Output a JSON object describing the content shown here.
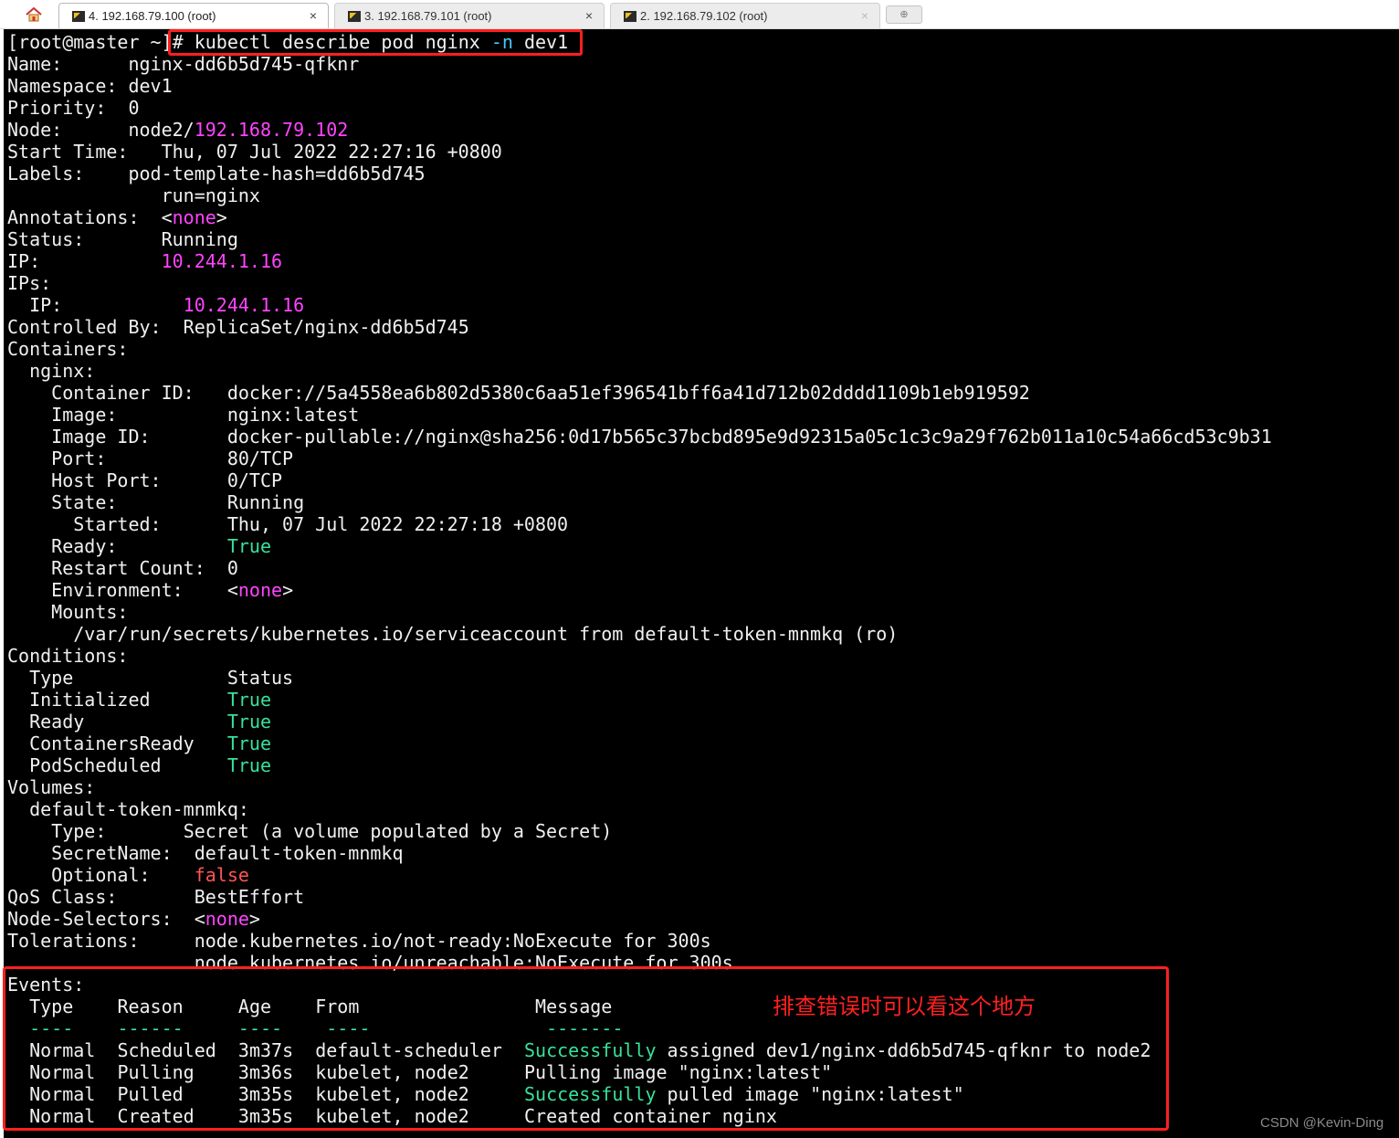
{
  "tabs": [
    {
      "label": "4. 192.168.79.100 (root)",
      "close": "×"
    },
    {
      "label": "3. 192.168.79.101 (root)",
      "close": "×"
    },
    {
      "label": "2. 192.168.79.102 (root)",
      "close": "×"
    }
  ],
  "prompt": "[root@master ~]",
  "command": {
    "prefix": "# kubectl describe pod nginx ",
    "flag": "-n",
    "suffix": " dev1"
  },
  "pod": {
    "name_label": "Name:",
    "name": "nginx-dd6b5d745-qfknr",
    "namespace_label": "Namespace:",
    "namespace": "dev1",
    "priority_label": "Priority:",
    "priority": "0",
    "node_label": "Node:",
    "node_prefix": "node2/",
    "node_ip": "192.168.79.102",
    "start_label": "Start Time:",
    "start_time": "Thu, 07 Jul 2022 22:27:16 +0800",
    "labels_label": "Labels:",
    "label1": "pod-template-hash=dd6b5d745",
    "label2": "run=nginx",
    "annotations_label": "Annotations:",
    "annotations": "none",
    "status_label": "Status:",
    "status": "Running",
    "ip_label": "IP:",
    "ip": "10.244.1.16",
    "ips_label": "IPs:",
    "ips_ip_label": "IP:",
    "ips_ip": "10.244.1.16",
    "controlled_label": "Controlled By:",
    "controlled_by": "ReplicaSet/nginx-dd6b5d745"
  },
  "containers": {
    "label": "Containers:",
    "name": "nginx:",
    "container_id_label": "Container ID:",
    "container_id": "docker://5a4558ea6b802d5380c6aa51ef396541bff6a41d712b02dddd1109b1eb919592",
    "image_label": "Image:",
    "image": "nginx:latest",
    "image_id_label": "Image ID:",
    "image_id": "docker-pullable://nginx@sha256:0d17b565c37bcbd895e9d92315a05c1c3c9a29f762b011a10c54a66cd53c9b31",
    "port_label": "Port:",
    "port": "80/TCP",
    "host_port_label": "Host Port:",
    "host_port": "0/TCP",
    "state_label": "State:",
    "state": "Running",
    "started_label": "Started:",
    "started": "Thu, 07 Jul 2022 22:27:18 +0800",
    "ready_label": "Ready:",
    "ready": "True",
    "restart_label": "Restart Count:",
    "restart": "0",
    "env_label": "Environment:",
    "env": "none",
    "mounts_label": "Mounts:",
    "mount": "/var/run/secrets/kubernetes.io/serviceaccount from default-token-mnmkq (ro)"
  },
  "conditions": {
    "label": "Conditions:",
    "type_header": "Type",
    "status_header": "Status",
    "rows": [
      {
        "type": "Initialized",
        "status": "True"
      },
      {
        "type": "Ready",
        "status": "True"
      },
      {
        "type": "ContainersReady",
        "status": "True"
      },
      {
        "type": "PodScheduled",
        "status": "True"
      }
    ]
  },
  "volumes": {
    "label": "Volumes:",
    "name": "default-token-mnmkq:",
    "type_label": "Type:",
    "type": "Secret (a volume populated by a Secret)",
    "secret_label": "SecretName:",
    "secret": "default-token-mnmkq",
    "optional_label": "Optional:",
    "optional": "false"
  },
  "qos_label": "QoS Class:",
  "qos": "BestEffort",
  "selectors_label": "Node-Selectors:",
  "selectors": "none",
  "tolerations_label": "Tolerations:",
  "toleration1": "node.kubernetes.io/not-ready:NoExecute for 300s",
  "toleration2": "node.kubernetes.io/unreachable:NoExecute for 300s",
  "events": {
    "label": "Events:",
    "headers": {
      "type": "Type",
      "reason": "Reason",
      "age": "Age",
      "from": "From",
      "message": "Message"
    },
    "dashes": {
      "type": "----",
      "reason": "------",
      "age": "----",
      "from": "----",
      "message": "-------"
    },
    "rows": [
      {
        "type": "Normal",
        "reason": "Scheduled",
        "age": "3m37s",
        "from": "default-scheduler",
        "msg_hl": "Successfully",
        "msg": " assigned dev1/nginx-dd6b5d745-qfknr to node2"
      },
      {
        "type": "Normal",
        "reason": "Pulling",
        "age": "3m36s",
        "from": "kubelet, node2",
        "msg_hl": "",
        "msg": "Pulling image \"nginx:latest\""
      },
      {
        "type": "Normal",
        "reason": "Pulled",
        "age": "3m35s",
        "from": "kubelet, node2",
        "msg_hl": "Successfully",
        "msg": " pulled image \"nginx:latest\""
      },
      {
        "type": "Normal",
        "reason": "Created",
        "age": "3m35s",
        "from": "kubelet, node2",
        "msg_hl": "",
        "msg": "Created container nginx"
      }
    ]
  },
  "annotation_note": "排查错误时可以看这个地方",
  "watermark": "CSDN @Kevin-Ding",
  "colors": {
    "highlight_box": "#ff1f1f",
    "magenta": "#ff44ff",
    "green": "#36e29a",
    "false_red": "#ff5555",
    "flag_cyan": "#47c8ff"
  }
}
